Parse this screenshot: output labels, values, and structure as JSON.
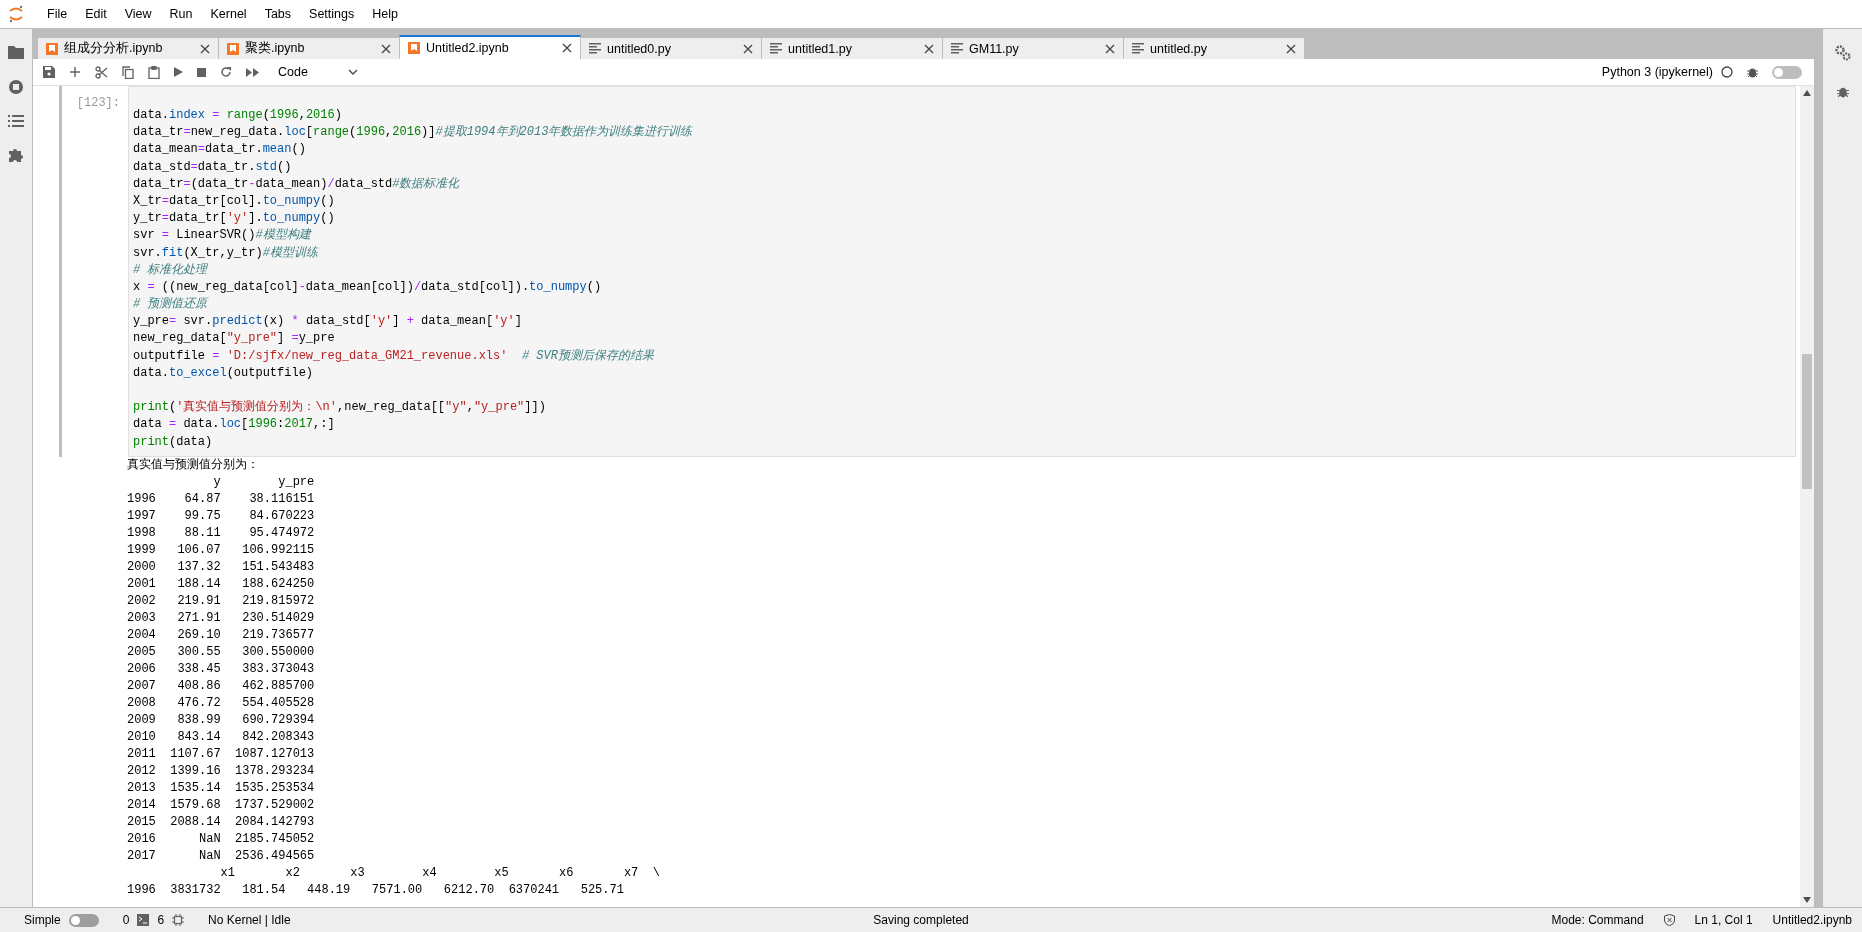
{
  "menu": [
    "File",
    "Edit",
    "View",
    "Run",
    "Kernel",
    "Tabs",
    "Settings",
    "Help"
  ],
  "tabs": [
    {
      "label": "组成分分析.ipynb",
      "kind": "notebook",
      "selected": false
    },
    {
      "label": "聚类.ipynb",
      "kind": "notebook",
      "selected": false
    },
    {
      "label": "Untitled2.ipynb",
      "kind": "notebook",
      "selected": true
    },
    {
      "label": "untitled0.py",
      "kind": "file",
      "selected": false
    },
    {
      "label": "untitled1.py",
      "kind": "file",
      "selected": false
    },
    {
      "label": "GM11.py",
      "kind": "file",
      "selected": false
    },
    {
      "label": "untitled.py",
      "kind": "file",
      "selected": false
    }
  ],
  "toolbar": {
    "cell_type": "Code",
    "kernel": "Python 3 (ipykernel)",
    "debugger_on": false
  },
  "cell": {
    "prompt": "[123]:",
    "lines": [
      {
        "tokens": [
          {
            "kind": "plain",
            "text": "data."
          },
          {
            "kind": "method",
            "text": "index"
          },
          {
            "kind": "op",
            "text": " = "
          },
          {
            "kind": "builtin",
            "text": "range"
          },
          {
            "kind": "plain",
            "text": "("
          },
          {
            "kind": "number",
            "text": "1996"
          },
          {
            "kind": "plain",
            "text": ","
          },
          {
            "kind": "number",
            "text": "2016"
          },
          {
            "kind": "plain",
            "text": ")"
          }
        ]
      },
      {
        "tokens": [
          {
            "kind": "plain",
            "text": "data_tr"
          },
          {
            "kind": "op",
            "text": "="
          },
          {
            "kind": "plain",
            "text": "new_reg_data."
          },
          {
            "kind": "method",
            "text": "loc"
          },
          {
            "kind": "plain",
            "text": "["
          },
          {
            "kind": "builtin",
            "text": "range"
          },
          {
            "kind": "plain",
            "text": "("
          },
          {
            "kind": "number",
            "text": "1996"
          },
          {
            "kind": "plain",
            "text": ","
          },
          {
            "kind": "number",
            "text": "2016"
          },
          {
            "kind": "plain",
            "text": ")]"
          },
          {
            "kind": "comment",
            "text": "#提取1994年到2013年数据作为训练集进行训练"
          }
        ]
      },
      {
        "tokens": [
          {
            "kind": "plain",
            "text": "data_mean"
          },
          {
            "kind": "op",
            "text": "="
          },
          {
            "kind": "plain",
            "text": "data_tr."
          },
          {
            "kind": "method",
            "text": "mean"
          },
          {
            "kind": "plain",
            "text": "()"
          }
        ]
      },
      {
        "tokens": [
          {
            "kind": "plain",
            "text": "data_std"
          },
          {
            "kind": "op",
            "text": "="
          },
          {
            "kind": "plain",
            "text": "data_tr."
          },
          {
            "kind": "method",
            "text": "std"
          },
          {
            "kind": "plain",
            "text": "()"
          }
        ]
      },
      {
        "tokens": [
          {
            "kind": "plain",
            "text": "data_tr"
          },
          {
            "kind": "op",
            "text": "="
          },
          {
            "kind": "plain",
            "text": "(data_tr"
          },
          {
            "kind": "op",
            "text": "-"
          },
          {
            "kind": "plain",
            "text": "data_mean)"
          },
          {
            "kind": "op",
            "text": "/"
          },
          {
            "kind": "plain",
            "text": "data_std"
          },
          {
            "kind": "comment",
            "text": "#数据标准化"
          }
        ]
      },
      {
        "tokens": [
          {
            "kind": "plain",
            "text": "X_tr"
          },
          {
            "kind": "op",
            "text": "="
          },
          {
            "kind": "plain",
            "text": "data_tr[col]."
          },
          {
            "kind": "method",
            "text": "to_numpy"
          },
          {
            "kind": "plain",
            "text": "()"
          }
        ]
      },
      {
        "tokens": [
          {
            "kind": "plain",
            "text": "y_tr"
          },
          {
            "kind": "op",
            "text": "="
          },
          {
            "kind": "plain",
            "text": "data_tr["
          },
          {
            "kind": "string",
            "text": "'y'"
          },
          {
            "kind": "plain",
            "text": "]."
          },
          {
            "kind": "method",
            "text": "to_numpy"
          },
          {
            "kind": "plain",
            "text": "()"
          }
        ]
      },
      {
        "tokens": [
          {
            "kind": "plain",
            "text": "svr"
          },
          {
            "kind": "op",
            "text": " = "
          },
          {
            "kind": "plain",
            "text": "LinearSVR()"
          },
          {
            "kind": "comment",
            "text": "#模型构建"
          }
        ]
      },
      {
        "tokens": [
          {
            "kind": "plain",
            "text": "svr."
          },
          {
            "kind": "method",
            "text": "fit"
          },
          {
            "kind": "plain",
            "text": "(X_tr,y_tr)"
          },
          {
            "kind": "comment",
            "text": "#模型训练"
          }
        ]
      },
      {
        "tokens": [
          {
            "kind": "comment",
            "text": "# 标准化处理"
          }
        ]
      },
      {
        "tokens": [
          {
            "kind": "plain",
            "text": "x"
          },
          {
            "kind": "op",
            "text": " = "
          },
          {
            "kind": "plain",
            "text": "((new_reg_data[col]"
          },
          {
            "kind": "op",
            "text": "-"
          },
          {
            "kind": "plain",
            "text": "data_mean[col])"
          },
          {
            "kind": "op",
            "text": "/"
          },
          {
            "kind": "plain",
            "text": "data_std[col])."
          },
          {
            "kind": "method",
            "text": "to_numpy"
          },
          {
            "kind": "plain",
            "text": "()"
          }
        ]
      },
      {
        "tokens": [
          {
            "kind": "comment",
            "text": "# 预测值还原"
          }
        ]
      },
      {
        "tokens": [
          {
            "kind": "plain",
            "text": "y_pre"
          },
          {
            "kind": "op",
            "text": "="
          },
          {
            "kind": "plain",
            "text": " svr."
          },
          {
            "kind": "method",
            "text": "predict"
          },
          {
            "kind": "plain",
            "text": "(x)"
          },
          {
            "kind": "op",
            "text": " * "
          },
          {
            "kind": "plain",
            "text": "data_std["
          },
          {
            "kind": "string",
            "text": "'y'"
          },
          {
            "kind": "plain",
            "text": "]"
          },
          {
            "kind": "op",
            "text": " + "
          },
          {
            "kind": "plain",
            "text": "data_mean["
          },
          {
            "kind": "string",
            "text": "'y'"
          },
          {
            "kind": "plain",
            "text": "]"
          }
        ]
      },
      {
        "tokens": [
          {
            "kind": "plain",
            "text": "new_reg_data["
          },
          {
            "kind": "string",
            "text": "\"y_pre\""
          },
          {
            "kind": "plain",
            "text": "]"
          },
          {
            "kind": "op",
            "text": " ="
          },
          {
            "kind": "plain",
            "text": "y_pre"
          }
        ]
      },
      {
        "tokens": [
          {
            "kind": "plain",
            "text": "outputfile"
          },
          {
            "kind": "op",
            "text": " = "
          },
          {
            "kind": "string",
            "text": "'D:/sjfx/new_reg_data_GM21_revenue.xls'"
          },
          {
            "kind": "comment",
            "text": "  # SVR预测后保存的结果"
          }
        ]
      },
      {
        "tokens": [
          {
            "kind": "plain",
            "text": "data."
          },
          {
            "kind": "method",
            "text": "to_excel"
          },
          {
            "kind": "plain",
            "text": "(outputfile)"
          }
        ]
      },
      {
        "blank_line_before": true,
        "tokens": [
          {
            "kind": "builtin",
            "text": "print"
          },
          {
            "kind": "plain",
            "text": "("
          },
          {
            "kind": "string",
            "text": "'真实值与预测值分别为：\\n'"
          },
          {
            "kind": "plain",
            "text": ",new_reg_data[["
          },
          {
            "kind": "string",
            "text": "\"y\""
          },
          {
            "kind": "plain",
            "text": ","
          },
          {
            "kind": "string",
            "text": "\"y_pre\""
          },
          {
            "kind": "plain",
            "text": "]])"
          }
        ]
      },
      {
        "tokens": [
          {
            "kind": "plain",
            "text": "data"
          },
          {
            "kind": "op",
            "text": " = "
          },
          {
            "kind": "plain",
            "text": "data."
          },
          {
            "kind": "method",
            "text": "loc"
          },
          {
            "kind": "plain",
            "text": "["
          },
          {
            "kind": "number",
            "text": "1996"
          },
          {
            "kind": "plain",
            "text": ":"
          },
          {
            "kind": "number",
            "text": "2017"
          },
          {
            "kind": "plain",
            "text": ",:]"
          }
        ]
      },
      {
        "tokens": [
          {
            "kind": "builtin",
            "text": "print"
          },
          {
            "kind": "plain",
            "text": "(data)"
          }
        ]
      }
    ],
    "output": [
      "真实值与预测值分别为：",
      "            y        y_pre",
      "1996    64.87    38.116151",
      "1997    99.75    84.670223",
      "1998    88.11    95.474972",
      "1999   106.07   106.992115",
      "2000   137.32   151.543483",
      "2001   188.14   188.624250",
      "2002   219.91   219.815972",
      "2003   271.91   230.514029",
      "2004   269.10   219.736577",
      "2005   300.55   300.550000",
      "2006   338.45   383.373043",
      "2007   408.86   462.885700",
      "2008   476.72   554.405528",
      "2009   838.99   690.729394",
      "2010   843.14   842.208343",
      "2011  1107.67  1087.127013",
      "2012  1399.16  1378.293234",
      "2013  1535.14  1535.253534",
      "2014  1579.68  1737.529002",
      "2015  2088.14  2084.142793",
      "2016      NaN  2185.745052",
      "2017      NaN  2536.494565",
      "             x1       x2       x3        x4        x5       x6       x7  \\",
      "1996  3831732   181.54   448.19   7571.00   6212.70  6370241   525.71"
    ]
  },
  "status": {
    "simple_mode": "Simple",
    "simple_on": false,
    "terminals": "0",
    "kernels": "6",
    "kernel_status": "No Kernel | Idle",
    "message": "Saving completed",
    "mode": "Mode: Command",
    "position": "Ln 1, Col 1",
    "file": "Untitled2.ipynb"
  }
}
